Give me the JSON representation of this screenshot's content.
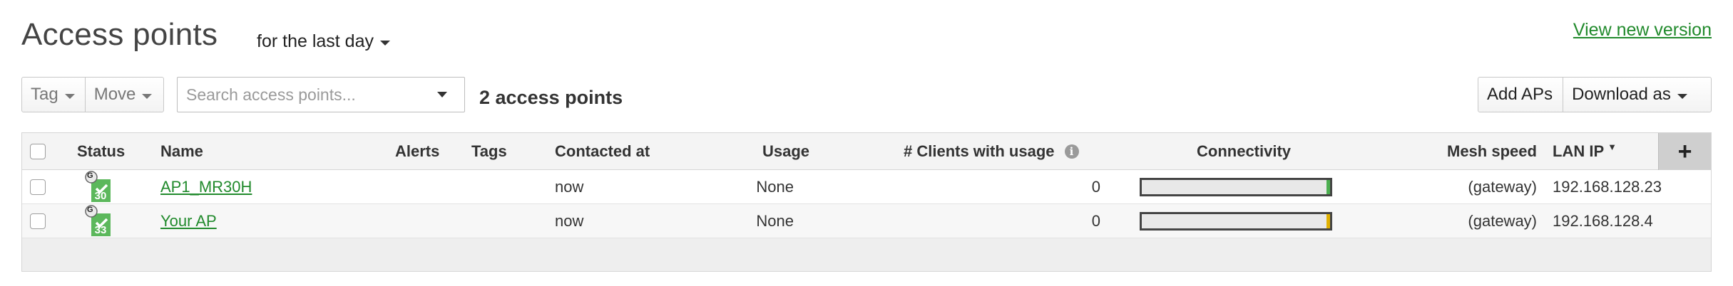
{
  "header": {
    "title": "Access points",
    "timespan": "for the last day",
    "view_new_version": "View new version"
  },
  "toolbar": {
    "tag_label": "Tag",
    "move_label": "Move",
    "search_placeholder": "Search access points...",
    "count_label": "2 access points",
    "add_aps_label": "Add APs",
    "download_as_label": "Download as"
  },
  "table": {
    "columns": {
      "status": "Status",
      "name": "Name",
      "alerts": "Alerts",
      "tags": "Tags",
      "contacted_at": "Contacted at",
      "usage": "Usage",
      "clients": "# Clients with usage",
      "connectivity": "Connectivity",
      "mesh_speed": "Mesh speed",
      "lan_ip": "LAN IP",
      "add_column": "+"
    },
    "rows": [
      {
        "status_badge": "G",
        "status_number": "30",
        "name": "AP1_MR30H",
        "alerts": "",
        "tags": "",
        "contacted_at": "now",
        "usage": "None",
        "clients": "0",
        "connectivity_status_color": "#4caf50",
        "mesh_speed": "(gateway)",
        "lan_ip": "192.168.128.23"
      },
      {
        "status_badge": "G",
        "status_number": "33",
        "name": "Your AP",
        "alerts": "",
        "tags": "",
        "contacted_at": "now",
        "usage": "None",
        "clients": "0",
        "connectivity_status_color": "#e0b000",
        "mesh_speed": "(gateway)",
        "lan_ip": "192.168.128.4"
      }
    ]
  },
  "colors": {
    "link_green": "#218a2c",
    "status_green": "#5cb85c"
  }
}
